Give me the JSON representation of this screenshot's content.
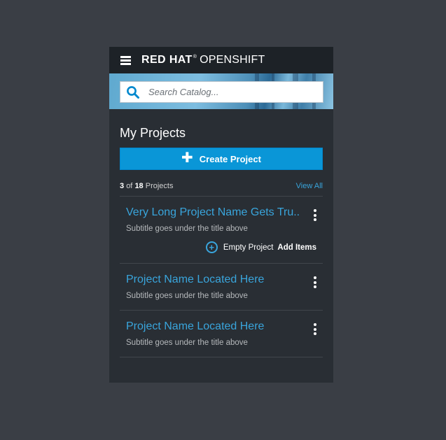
{
  "masthead": {
    "brand_bold": "RED HAT",
    "brand_mark": "®",
    "brand_product": "OPENSHIFT"
  },
  "search": {
    "placeholder": "Search Catalog..."
  },
  "projects_section": {
    "title": "My Projects",
    "create_label": "Create Project",
    "count_shown": "3",
    "count_of": "of",
    "count_total": "18",
    "count_suffix": "Projects",
    "view_all_label": "View All",
    "items": [
      {
        "title": "Very Long Project Name Gets Tru..",
        "subtitle": "Subtitle goes under the title above",
        "empty_label": "Empty Project",
        "add_items_label": "Add Items"
      },
      {
        "title": "Project Name Located Here",
        "subtitle": "Subtitle goes under the title above"
      },
      {
        "title": "Project Name Located Here",
        "subtitle": "Subtitle goes under the title above"
      }
    ]
  },
  "icons": {
    "menu": "hamburger-icon",
    "search": "search-icon",
    "create": "plus-icon",
    "kebab": "kebab-icon",
    "add": "add-circle-icon"
  },
  "colors": {
    "accent": "#0088ce",
    "link": "#39a5dc",
    "masthead_bg": "#1d2227",
    "panel_bg": "#292e34",
    "page_bg": "#3a3e45"
  }
}
